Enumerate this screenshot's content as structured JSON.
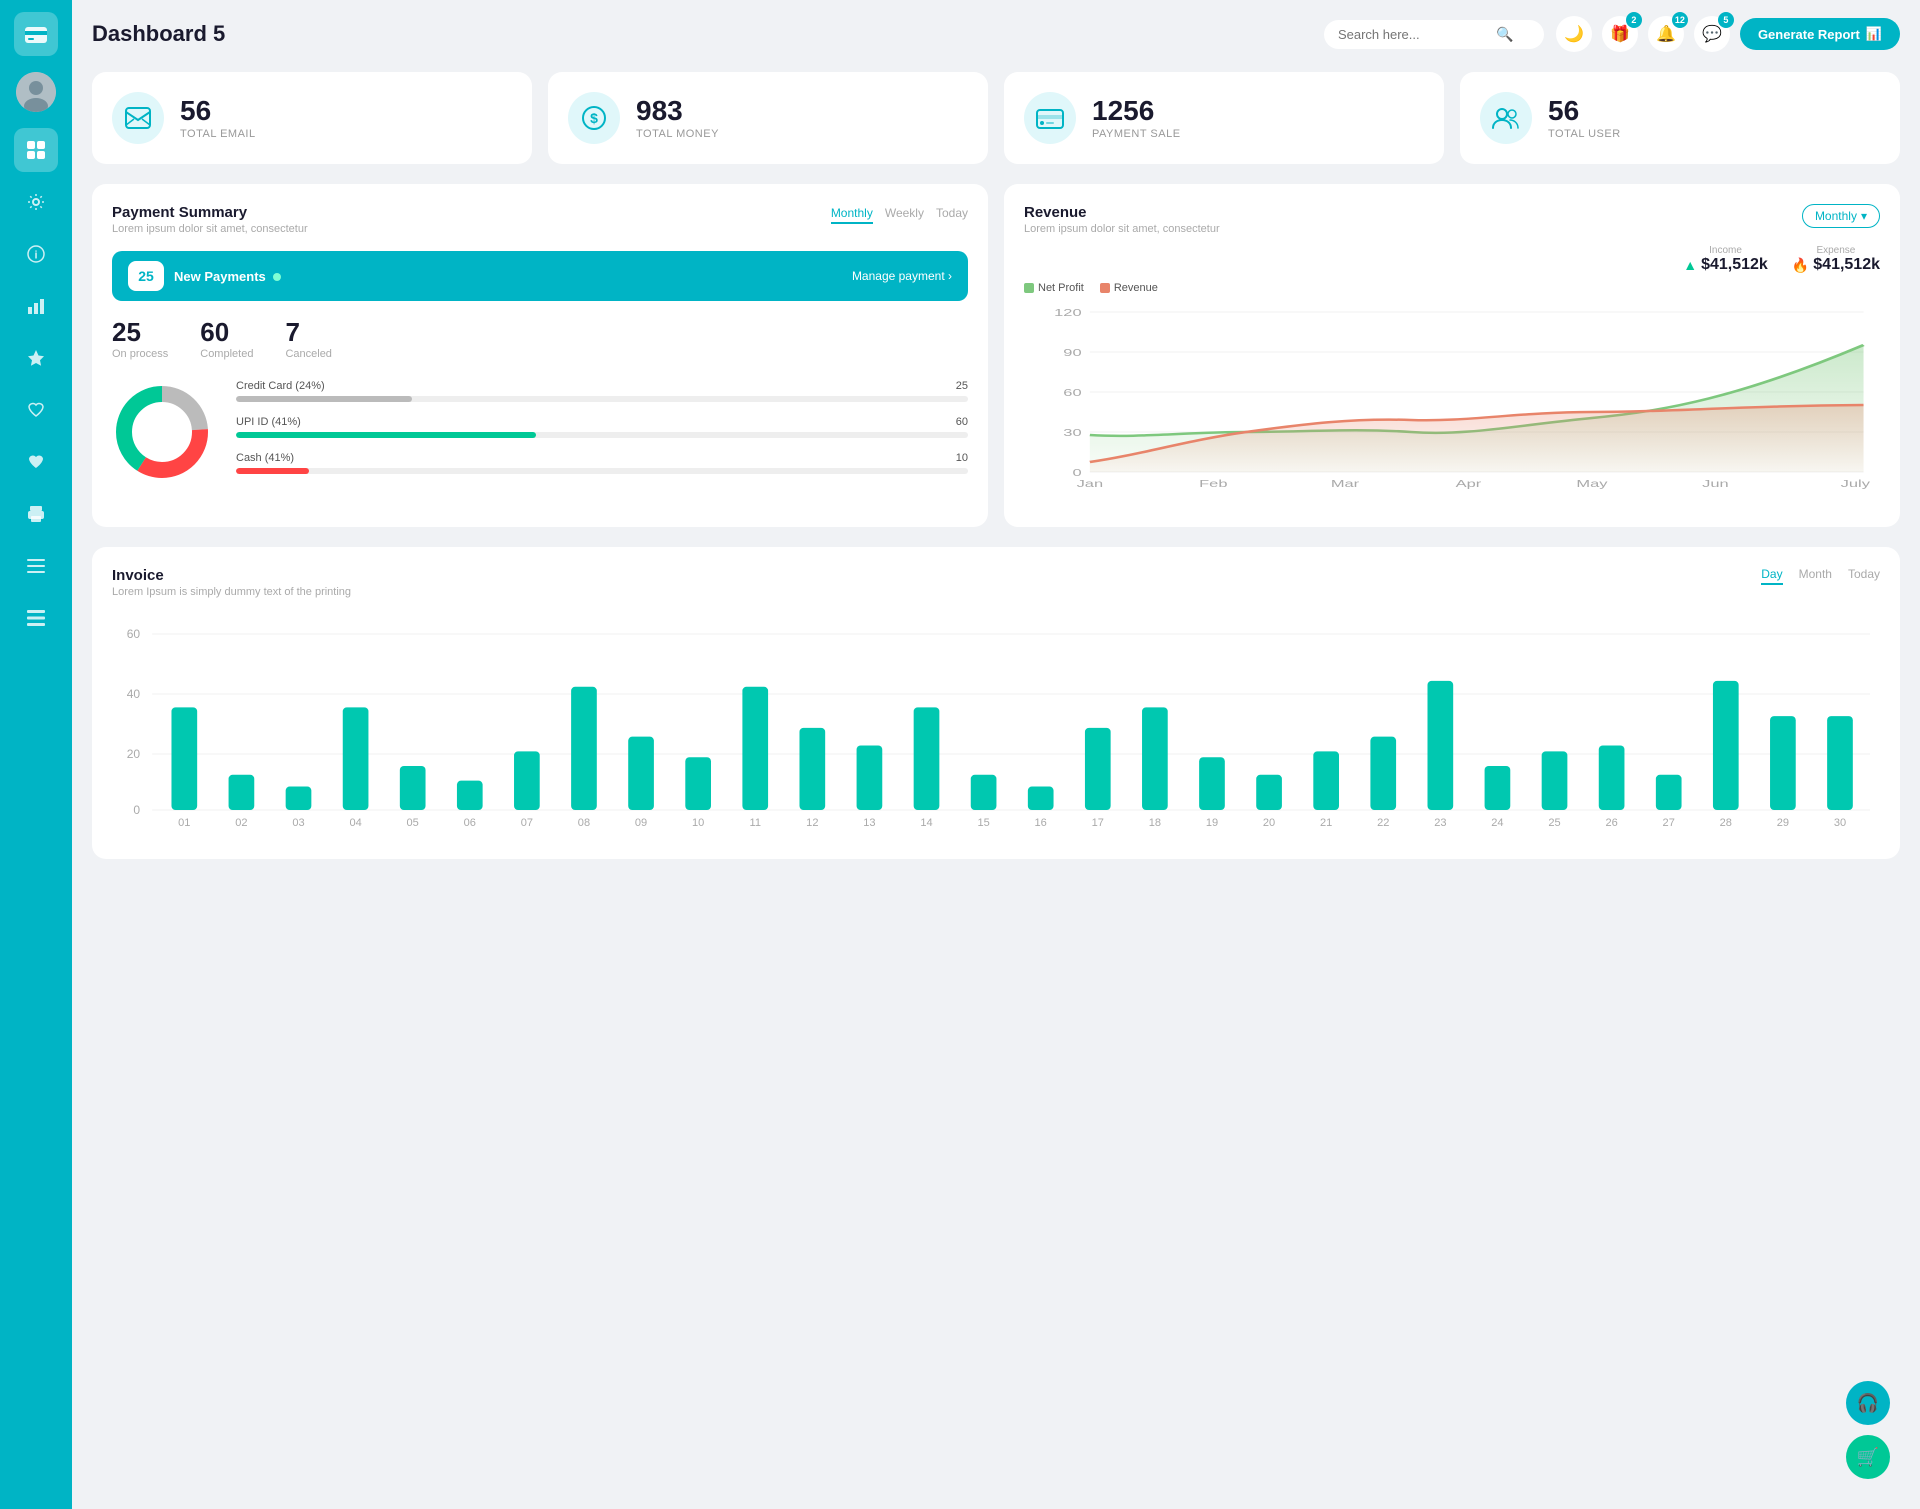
{
  "sidebar": {
    "logo_icon": "💳",
    "items": [
      {
        "id": "dashboard",
        "icon": "⊞",
        "active": true
      },
      {
        "id": "settings",
        "icon": "⚙"
      },
      {
        "id": "info",
        "icon": "ℹ"
      },
      {
        "id": "analytics",
        "icon": "📊"
      },
      {
        "id": "star",
        "icon": "★"
      },
      {
        "id": "heart-outline",
        "icon": "♡"
      },
      {
        "id": "heart-filled",
        "icon": "♥"
      },
      {
        "id": "printer",
        "icon": "🖨"
      },
      {
        "id": "menu",
        "icon": "☰"
      },
      {
        "id": "list",
        "icon": "📋"
      }
    ]
  },
  "header": {
    "title": "Dashboard 5",
    "search_placeholder": "Search here...",
    "generate_btn": "Generate Report",
    "badges": {
      "gift": "2",
      "bell": "12",
      "chat": "5"
    }
  },
  "stat_cards": [
    {
      "id": "email",
      "number": "56",
      "label": "TOTAL EMAIL",
      "icon": "📧"
    },
    {
      "id": "money",
      "number": "983",
      "label": "TOTAL MONEY",
      "icon": "💲"
    },
    {
      "id": "payment",
      "number": "1256",
      "label": "PAYMENT SALE",
      "icon": "💳"
    },
    {
      "id": "user",
      "number": "56",
      "label": "TOTAL USER",
      "icon": "👥"
    }
  ],
  "payment_summary": {
    "title": "Payment Summary",
    "subtitle": "Lorem ipsum dolor sit amet, consectetur",
    "tabs": [
      "Monthly",
      "Weekly",
      "Today"
    ],
    "active_tab": "Monthly",
    "new_payments": {
      "count": "25",
      "label": "New Payments",
      "manage_link": "Manage payment ›"
    },
    "stats": [
      {
        "value": "25",
        "label": "On process"
      },
      {
        "value": "60",
        "label": "Completed"
      },
      {
        "value": "7",
        "label": "Canceled"
      }
    ],
    "payment_methods": [
      {
        "label": "Credit Card (24%)",
        "pct": 24,
        "color": "gray",
        "count": "25"
      },
      {
        "label": "UPI ID (41%)",
        "pct": 41,
        "color": "green",
        "count": "60"
      },
      {
        "label": "Cash (41%)",
        "pct": 10,
        "color": "red",
        "count": "10"
      }
    ],
    "donut": {
      "gray_pct": 24,
      "green_pct": 41,
      "red_pct": 35
    }
  },
  "revenue": {
    "title": "Revenue",
    "subtitle": "Lorem ipsum dolor sit amet, consectetur",
    "tab": "Monthly",
    "income_label": "Income",
    "income_value": "$41,512k",
    "expense_label": "Expense",
    "expense_value": "$41,512k",
    "legend": [
      {
        "label": "Net Profit",
        "color": "#7ec87e"
      },
      {
        "label": "Revenue",
        "color": "#e8846a"
      }
    ],
    "x_labels": [
      "Jan",
      "Feb",
      "Mar",
      "Apr",
      "May",
      "Jun",
      "July"
    ],
    "y_labels": [
      "0",
      "30",
      "60",
      "90",
      "120"
    ],
    "net_profit_data": [
      28,
      25,
      30,
      28,
      35,
      45,
      95
    ],
    "revenue_data": [
      8,
      20,
      38,
      35,
      45,
      52,
      45
    ]
  },
  "invoice": {
    "title": "Invoice",
    "subtitle": "Lorem Ipsum is simply dummy text of the printing",
    "tabs": [
      "Day",
      "Month",
      "Today"
    ],
    "active_tab": "Day",
    "y_labels": [
      "0",
      "20",
      "40",
      "60"
    ],
    "x_labels": [
      "01",
      "02",
      "03",
      "04",
      "05",
      "06",
      "07",
      "08",
      "09",
      "10",
      "11",
      "12",
      "13",
      "14",
      "15",
      "16",
      "17",
      "18",
      "19",
      "20",
      "21",
      "22",
      "23",
      "24",
      "25",
      "26",
      "27",
      "28",
      "29",
      "30"
    ],
    "bar_data": [
      35,
      12,
      8,
      35,
      15,
      10,
      20,
      42,
      25,
      18,
      42,
      28,
      22,
      35,
      12,
      8,
      28,
      35,
      18,
      12,
      20,
      25,
      44,
      15,
      20,
      22,
      12,
      44,
      32,
      32
    ]
  },
  "fabs": [
    {
      "id": "support",
      "icon": "🎧",
      "color": "#00b4c5"
    },
    {
      "id": "cart",
      "icon": "🛒",
      "color": "#00c896"
    }
  ]
}
